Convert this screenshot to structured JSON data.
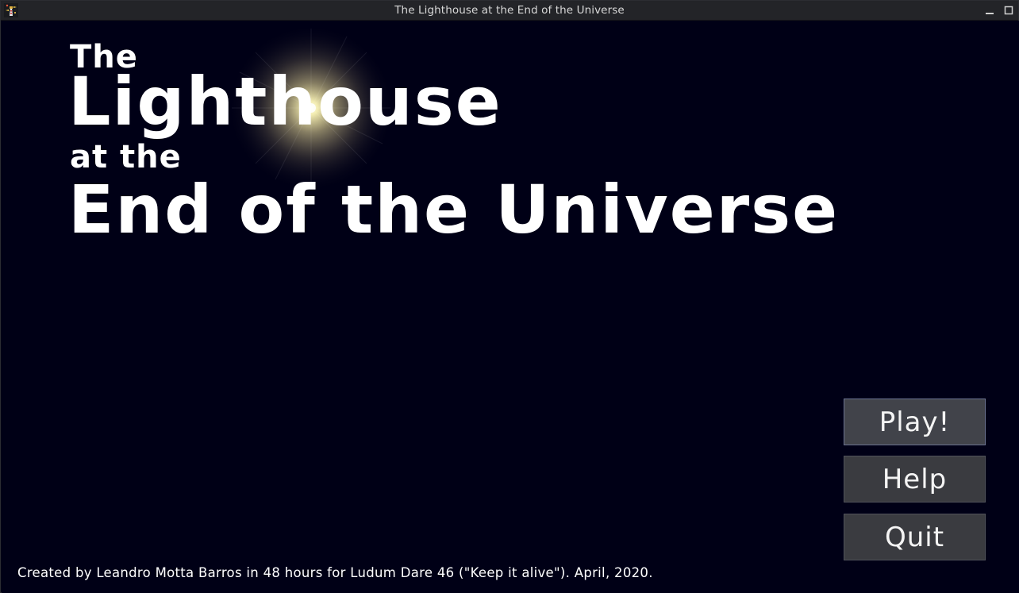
{
  "window": {
    "title": "The Lighthouse at the End of the Universe",
    "app_icon": "lighthouse-app-icon",
    "controls": [
      "minimize-icon",
      "maximize-icon"
    ]
  },
  "game_title": {
    "line1": "The",
    "line2": "Lighthouse",
    "line3": "at the",
    "line4": "End of the Universe"
  },
  "menu": {
    "play_label": "Play!",
    "help_label": "Help",
    "quit_label": "Quit",
    "selected": "play"
  },
  "footer": {
    "credits": "Created by Leandro Motta Barros in 48 hours for Ludum Dare 46 (\"Keep it alive\"). April, 2020."
  },
  "colors": {
    "background": "#000016",
    "title_text": "#ffffff",
    "button_bg": "#3a3b40",
    "button_border_selected": "#6b7390",
    "glow": "#fff6b0",
    "titlebar": "#232428"
  }
}
